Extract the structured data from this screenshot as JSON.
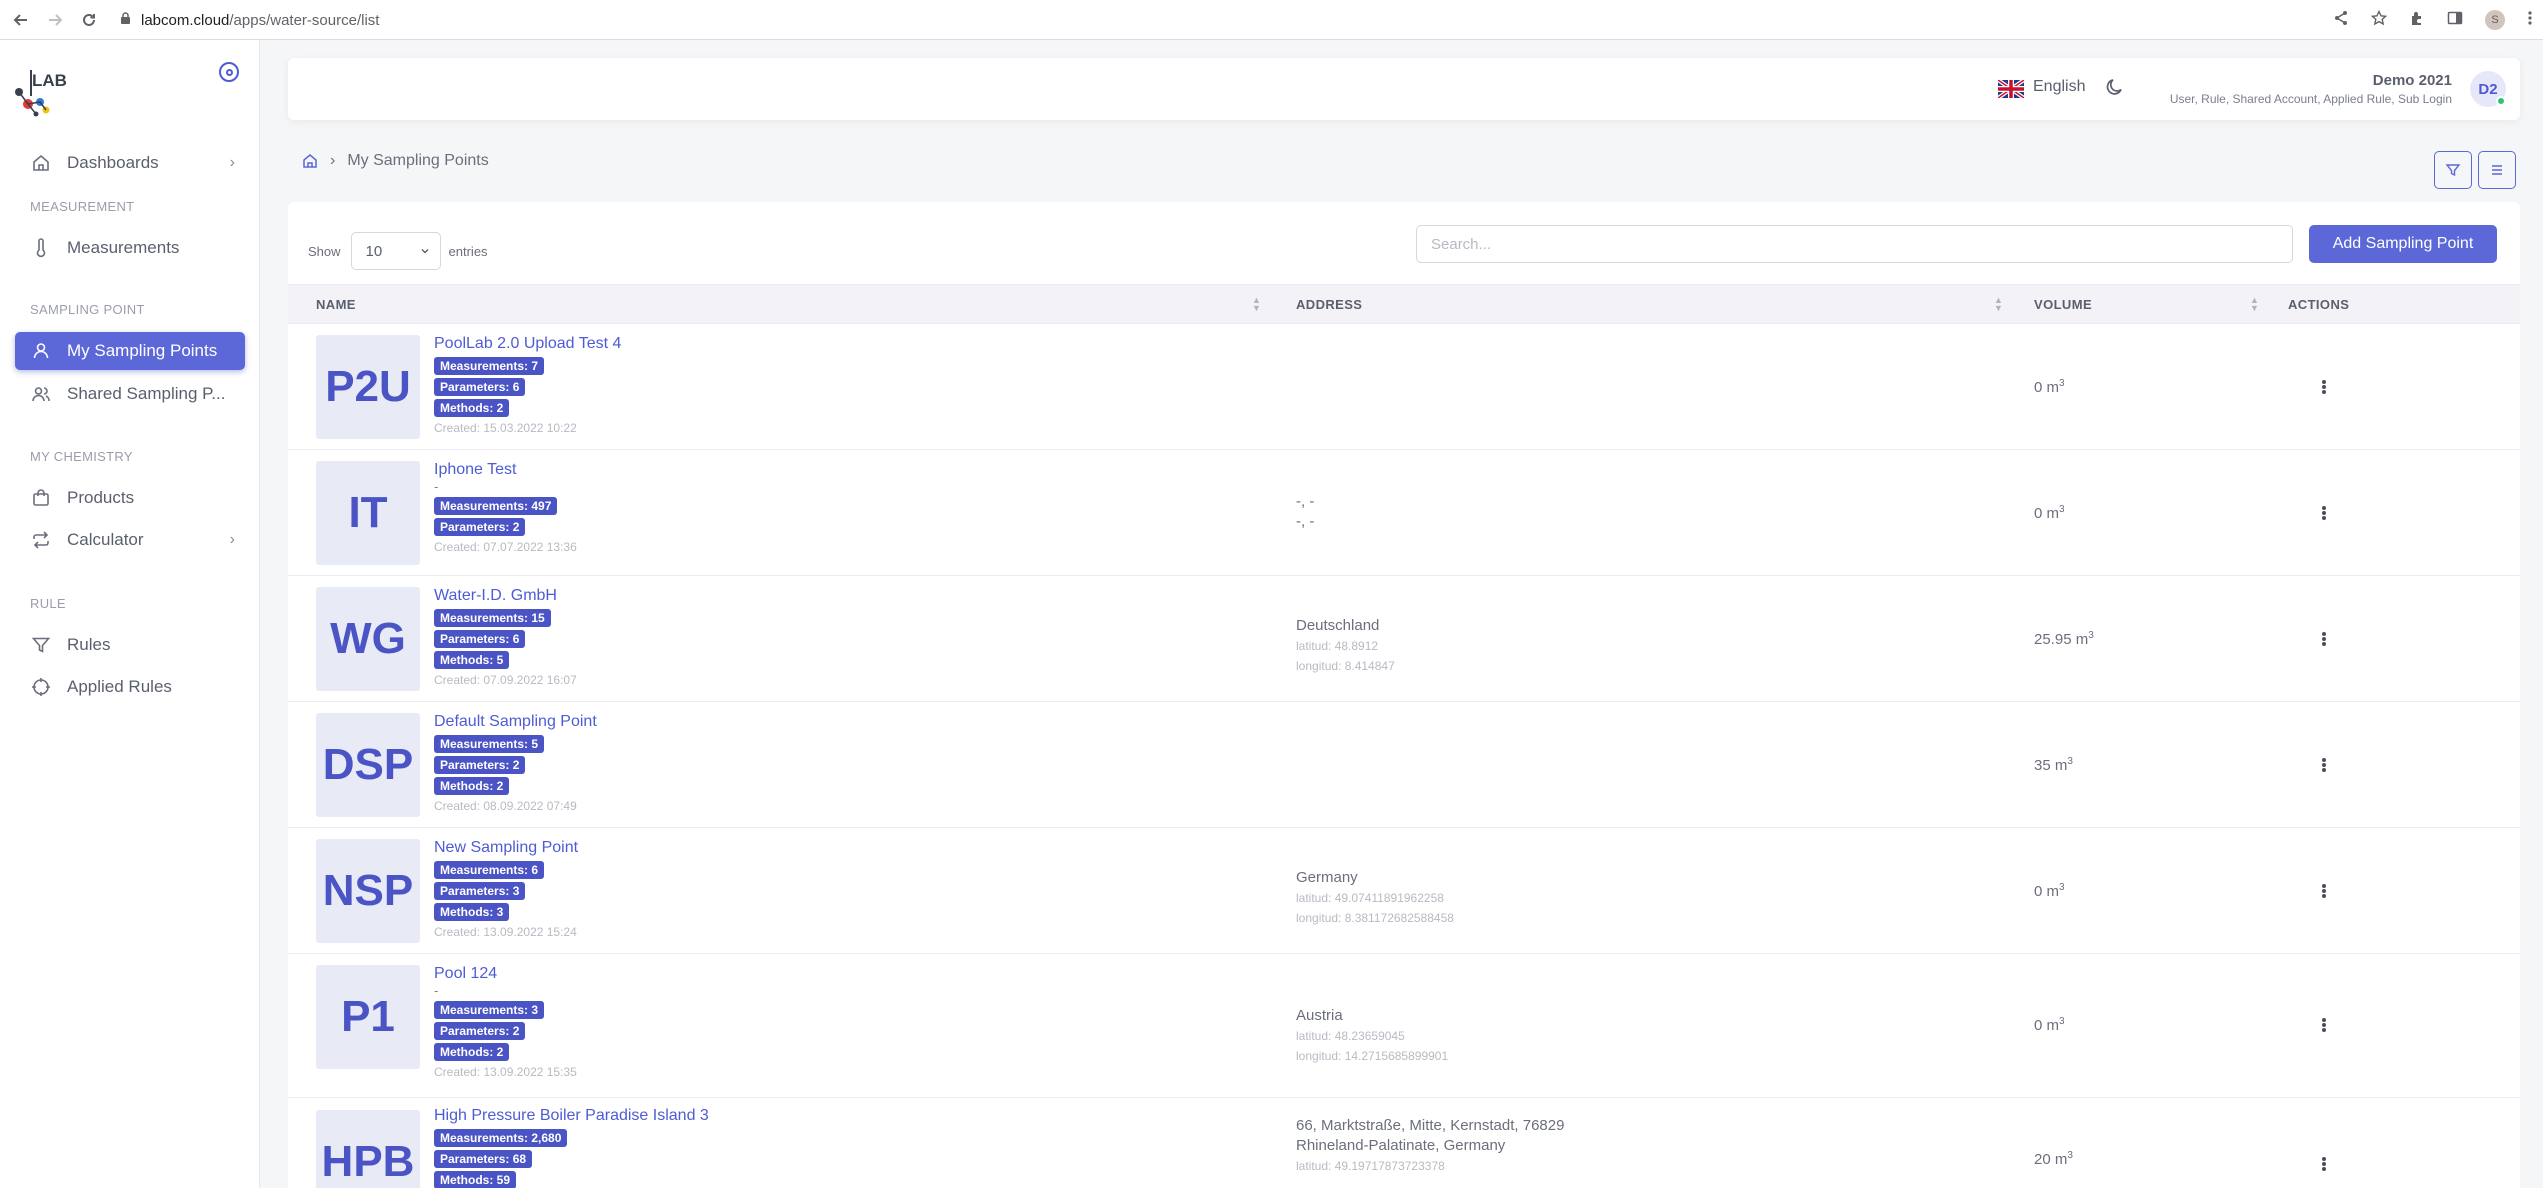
{
  "browser": {
    "url_host": "labcom.cloud",
    "url_path": "/apps/water-source/list",
    "profile_initial": "S"
  },
  "sidebar": {
    "items": [
      {
        "label": "Dashboards",
        "icon": "home-icon"
      },
      {
        "label": "Measurements",
        "icon": "thermometer-icon"
      },
      {
        "label": "My Sampling Points",
        "icon": "user-icon"
      },
      {
        "label": "Shared Sampling P...",
        "icon": "users-icon"
      },
      {
        "label": "Products",
        "icon": "shopping-bag-icon"
      },
      {
        "label": "Calculator",
        "icon": "repeat-icon"
      },
      {
        "label": "Rules",
        "icon": "filter-icon"
      },
      {
        "label": "Applied Rules",
        "icon": "target-icon"
      }
    ],
    "sections": [
      "MEASUREMENT",
      "SAMPLING POINT",
      "MY CHEMISTRY",
      "RULE"
    ],
    "logo_text": "LAB"
  },
  "header": {
    "language": "English",
    "user_name": "Demo 2021",
    "user_roles": "User, Rule, Shared Account, Applied Rule, Sub Login",
    "avatar_initials": "D2"
  },
  "breadcrumb": {
    "current": "My Sampling Points"
  },
  "table_controls": {
    "show_label": "Show",
    "entries_value": "10",
    "entries_label": "entries",
    "search_placeholder": "Search...",
    "add_button": "Add Sampling Point"
  },
  "columns": [
    "NAME",
    "ADDRESS",
    "VOLUME",
    "ACTIONS"
  ],
  "rows": [
    {
      "abbr": "P2U",
      "name": "PoolLab 2.0 Upload Test 4",
      "dash": "",
      "measurements": "Measurements: 7",
      "parameters": "Parameters: 6",
      "methods": "Methods: 2",
      "created": "Created: 15.03.2022 10:22",
      "addr1": "",
      "addr2": "",
      "addr3": "",
      "volume": "0 m",
      "vol_unit": "3"
    },
    {
      "abbr": "IT",
      "name": "Iphone Test",
      "dash": "-",
      "measurements": "Measurements: 497",
      "parameters": "Parameters: 2",
      "methods": "",
      "created": "Created: 07.07.2022 13:36",
      "addr1": "-, -",
      "addr2": "-, -",
      "addr3": "",
      "volume": "0 m",
      "vol_unit": "3"
    },
    {
      "abbr": "WG",
      "name": "Water-I.D. GmbH",
      "dash": "",
      "measurements": "Measurements: 15",
      "parameters": "Parameters: 6",
      "methods": "Methods: 5",
      "created": "Created: 07.09.2022 16:07",
      "addr1": "Deutschland",
      "addr2": "latitud: 48.8912",
      "addr3": "longitud: 8.414847",
      "volume": "25.95 m",
      "vol_unit": "3"
    },
    {
      "abbr": "DSP",
      "name": "Default Sampling Point",
      "dash": "",
      "measurements": "Measurements: 5",
      "parameters": "Parameters: 2",
      "methods": "Methods: 2",
      "created": "Created: 08.09.2022 07:49",
      "addr1": "",
      "addr2": "",
      "addr3": "",
      "volume": "35 m",
      "vol_unit": "3"
    },
    {
      "abbr": "NSP",
      "name": "New Sampling Point",
      "dash": "",
      "measurements": "Measurements: 6",
      "parameters": "Parameters: 3",
      "methods": "Methods: 3",
      "created": "Created: 13.09.2022 15:24",
      "addr1": "Germany",
      "addr2": "latitud: 49.07411891962258",
      "addr3": "longitud: 8.381172682588458",
      "volume": "0 m",
      "vol_unit": "3"
    },
    {
      "abbr": "P1",
      "name": "Pool 124",
      "dash": "-",
      "measurements": "Measurements: 3",
      "parameters": "Parameters: 2",
      "methods": "Methods: 2",
      "created": "Created: 13.09.2022 15:35",
      "addr1": "Austria",
      "addr2": "latitud: 48.23659045",
      "addr3": "longitud: 14.2715685899901",
      "volume": "0 m",
      "vol_unit": "3"
    },
    {
      "abbr": "HPB",
      "name": "High Pressure Boiler Paradise Island 3",
      "dash": "",
      "measurements": "Measurements: 2,680",
      "parameters": "Parameters: 68",
      "methods": "Methods: 59",
      "created": "",
      "addr1": "66, Marktstraße, Mitte, Kernstadt, 76829",
      "addr2": "Rhineland-Palatinate, Germany",
      "addr3": "latitud: 49.19717873723378",
      "volume": "20 m",
      "vol_unit": "3"
    }
  ],
  "colors": {
    "accent": "#5c67d8",
    "badge": "#4a54c4"
  }
}
